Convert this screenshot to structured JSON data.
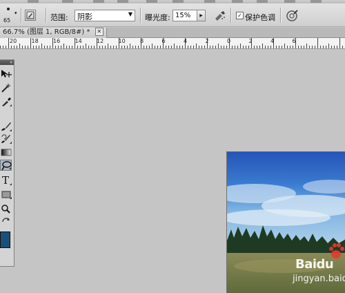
{
  "options_bar": {
    "brush_size": "65",
    "range_label": "范围:",
    "range_value": "阴影",
    "exposure_label": "曝光度:",
    "exposure_value": "15%",
    "protect_tones_label": "保护色调",
    "protect_tones_checked": true
  },
  "document": {
    "tab_title": "66.7% (图层 1, RGB/8#) *",
    "close_symbol": "✕"
  },
  "ruler": {
    "labels": [
      "20",
      "18",
      "16",
      "14",
      "12",
      "10",
      "8",
      "6",
      "4",
      "2",
      "0",
      "2",
      "4",
      "6"
    ]
  },
  "tools": {
    "items": [
      "move-tool",
      "magic-wand-tool",
      "eyedropper-tool",
      "brush-tool",
      "history-brush-tool",
      "gradient-tool",
      "dodge-tool",
      "type-tool",
      "shape-tool",
      "zoom-tool",
      "rotate-tool"
    ],
    "active": "dodge-tool",
    "type_glyph": "T",
    "foreground_color": "#1a4f7a"
  },
  "watermark": {
    "logo_text": "Baidu",
    "url_text": "jingyan.baidu"
  }
}
